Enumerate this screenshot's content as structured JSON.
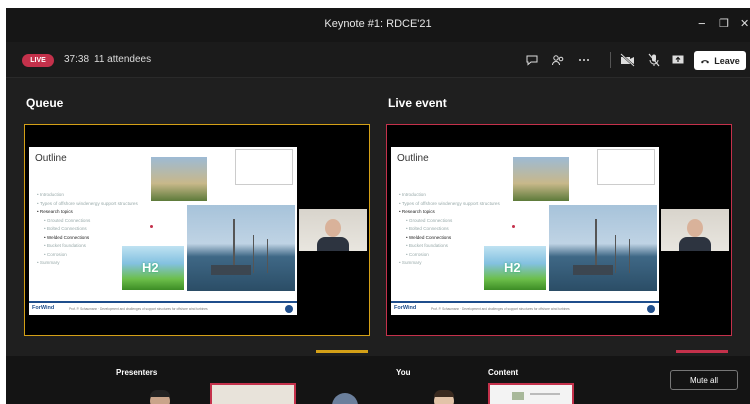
{
  "window": {
    "title": "Keynote #1: RDCE'21",
    "minimize_glyph": "−",
    "restore_glyph": "❐",
    "close_glyph": "✕"
  },
  "toolbar": {
    "live_badge": "LIVE",
    "timer": "37:38",
    "attendees": "11 attendees",
    "icons": [
      "chat-icon",
      "people-icon",
      "more-options-icon",
      "camera-off-icon",
      "mic-off-icon",
      "share-screen-icon"
    ],
    "leave_label": "Leave",
    "accent_color": "#c4314b"
  },
  "queue": {
    "label": "Queue",
    "border_color": "#d4a017"
  },
  "live_event": {
    "label": "Live event",
    "border_color": "#c4314b"
  },
  "slide": {
    "title": "Outline",
    "bullets": [
      {
        "text": "Introduction",
        "sub": false,
        "highlight": false
      },
      {
        "text": "Types of offshore windenergy support structures",
        "sub": false,
        "highlight": false
      },
      {
        "text": "Research topics",
        "sub": false,
        "highlight": true
      },
      {
        "text": "Grouted Connections",
        "sub": true,
        "highlight": false
      },
      {
        "text": "Bolted Connections",
        "sub": true,
        "highlight": false
      },
      {
        "text": "Welded Connections",
        "sub": true,
        "highlight": true
      },
      {
        "text": "Bucket foundations",
        "sub": true,
        "highlight": false
      },
      {
        "text": "Corrosion",
        "sub": true,
        "highlight": false
      },
      {
        "text": "Summary",
        "sub": false,
        "highlight": false
      }
    ],
    "h2_label": "H2",
    "footer_brand": "ForWind",
    "footer_text": "Prof. P. Schaumann · Development and challenges of support structures for offshore wind turbines"
  },
  "bottom": {
    "presenters_label": "Presenters",
    "you_label": "You",
    "content_label": "Content",
    "mute_all_label": "Mute all"
  }
}
